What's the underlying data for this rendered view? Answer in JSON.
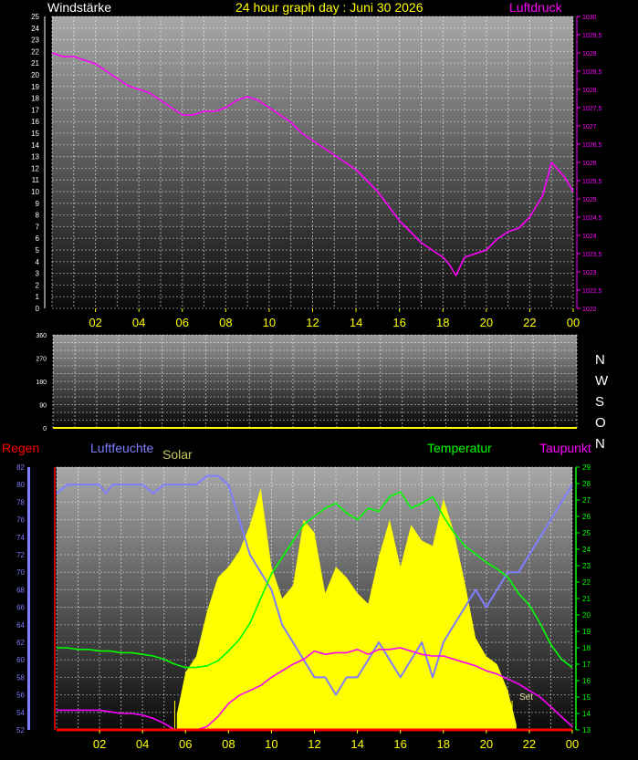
{
  "header": {
    "left_label": "Windstärke",
    "title": "24 hour graph day : Juni 30 2026",
    "right_label": "Luftdruck"
  },
  "bottom_legend": {
    "rain": "Regen",
    "humidity": "Luftfeuchte",
    "solar": "Solar",
    "temperature": "Temperatur",
    "dewpoint": "Taupunkt",
    "sunset_marker": "Set"
  },
  "compass": [
    "N",
    "W",
    "S",
    "O",
    "N"
  ],
  "colors": {
    "pressure": "#ff00ff",
    "temperature": "#00ff00",
    "dewpoint": "#ff00ff",
    "humidity": "#7f7fff",
    "solar": "#ffff00",
    "rain": "#ff0000",
    "hour_labels": "#ffff00"
  },
  "chart_data": [
    {
      "type": "line",
      "name": "wind_pressure",
      "x_ticks": [
        "02",
        "04",
        "06",
        "08",
        "10",
        "12",
        "14",
        "16",
        "18",
        "20",
        "22",
        "00"
      ],
      "y_left": {
        "min": 0,
        "max": 25,
        "ticks": [
          "0",
          "1",
          "2",
          "3",
          "4",
          "5",
          "6",
          "7",
          "8",
          "9",
          "10",
          "11",
          "12",
          "13",
          "14",
          "15",
          "16",
          "17",
          "18",
          "19",
          "20",
          "21",
          "22",
          "23",
          "24",
          "25"
        ]
      },
      "y_right": {
        "min": 1022,
        "max": 1030,
        "ticks": [
          "1022",
          "1022,5",
          "1023",
          "1023,5",
          "1024",
          "1024,5",
          "1025",
          "1025,5",
          "1026",
          "1026,5",
          "1027",
          "1027,5",
          "1028",
          "1028,5",
          "1029",
          "1029,5",
          "1030"
        ]
      },
      "series": [
        {
          "key": "pressure",
          "axis": "right",
          "x": [
            0,
            0.5,
            1,
            1.5,
            2,
            2.5,
            3,
            3.5,
            4,
            4.5,
            5,
            5.5,
            6,
            6.5,
            7,
            7.5,
            8,
            8.5,
            9,
            9.5,
            10,
            10.5,
            11,
            11.5,
            12,
            12.5,
            13,
            13.5,
            14,
            14.5,
            15,
            15.5,
            16,
            16.5,
            17,
            17.5,
            18,
            18.3,
            18.6,
            19,
            19.5,
            20,
            20.5,
            21,
            21.5,
            22,
            22.3,
            22.6,
            23,
            23.3,
            23.6,
            24
          ],
          "y": [
            1029,
            1028.9,
            1028.9,
            1028.8,
            1028.7,
            1028.5,
            1028.3,
            1028.1,
            1028,
            1027.9,
            1027.7,
            1027.5,
            1027.3,
            1027.3,
            1027.4,
            1027.4,
            1027.5,
            1027.7,
            1027.8,
            1027.7,
            1027.5,
            1027.3,
            1027.1,
            1026.8,
            1026.6,
            1026.4,
            1026.2,
            1026,
            1025.8,
            1025.5,
            1025.2,
            1024.8,
            1024.4,
            1024.1,
            1023.8,
            1023.6,
            1023.4,
            1023.2,
            1022.9,
            1023.4,
            1023.5,
            1023.6,
            1023.9,
            1024.1,
            1024.2,
            1024.5,
            1024.8,
            1025.1,
            1026,
            1025.8,
            1025.6,
            1025.2
          ]
        }
      ]
    },
    {
      "type": "line",
      "name": "wind_direction",
      "x_ticks": [],
      "y_left": {
        "min": 0,
        "max": 360,
        "ticks": [
          "0",
          "90",
          "180",
          "270",
          "360"
        ]
      },
      "series": []
    },
    {
      "type": "line",
      "name": "weather",
      "x_ticks": [
        "02",
        "04",
        "06",
        "08",
        "10",
        "12",
        "14",
        "16",
        "18",
        "20",
        "22",
        "00"
      ],
      "y_left": {
        "min": 52,
        "max": 82,
        "ticks": [
          "52",
          "54",
          "56",
          "58",
          "60",
          "62",
          "64",
          "66",
          "68",
          "70",
          "72",
          "74",
          "76",
          "78",
          "80",
          "82"
        ]
      },
      "y_right": {
        "min": 13,
        "max": 29,
        "ticks": [
          "13",
          "14",
          "15",
          "16",
          "17",
          "18",
          "19",
          "20",
          "21",
          "22",
          "23",
          "24",
          "25",
          "26",
          "27",
          "28",
          "29"
        ]
      },
      "series": [
        {
          "key": "humidity",
          "axis": "left",
          "x": [
            0,
            0.5,
            1,
            2,
            2.3,
            2.6,
            3,
            4,
            4.5,
            5,
            6,
            6.5,
            7,
            7.5,
            8,
            8.5,
            9,
            9.5,
            10,
            10.5,
            11,
            11.5,
            12,
            12.5,
            13,
            13.5,
            14,
            14.5,
            15,
            15.5,
            16,
            16.5,
            17,
            17.5,
            18,
            18.5,
            19,
            19.5,
            20,
            20.5,
            21,
            21.5,
            22,
            22.5,
            23,
            23.5,
            24
          ],
          "y": [
            79,
            80,
            80,
            80,
            79,
            80,
            80,
            80,
            79,
            80,
            80,
            80,
            81,
            81,
            80,
            76,
            72,
            70,
            68,
            64,
            62,
            60,
            58,
            58,
            56,
            58,
            58,
            60,
            62,
            60,
            58,
            60,
            62,
            58,
            62,
            64,
            66,
            68,
            66,
            68,
            70,
            70,
            72,
            74,
            76,
            78,
            80
          ]
        },
        {
          "key": "temperature",
          "axis": "right",
          "x": [
            0,
            0.5,
            1,
            1.5,
            2,
            2.5,
            3,
            3.5,
            4,
            4.5,
            5,
            5.5,
            6,
            6.5,
            7,
            7.5,
            8,
            8.5,
            9,
            9.5,
            10,
            10.5,
            11,
            11.5,
            12,
            12.5,
            13,
            13.5,
            14,
            14.5,
            15,
            15.5,
            16,
            16.5,
            17,
            17.5,
            18,
            18.5,
            19,
            19.5,
            20,
            20.5,
            21,
            21.5,
            22,
            22.5,
            23,
            23.5,
            24
          ],
          "y": [
            18,
            18,
            17.9,
            17.9,
            17.8,
            17.8,
            17.7,
            17.7,
            17.6,
            17.5,
            17.3,
            17.0,
            16.8,
            16.8,
            16.9,
            17.2,
            17.8,
            18.5,
            19.5,
            21,
            22.5,
            23.5,
            24.5,
            25.5,
            26,
            26.5,
            26.8,
            26.2,
            25.8,
            26.5,
            26.3,
            27.2,
            27.5,
            26.5,
            26.8,
            27.2,
            26,
            25,
            24.2,
            23.7,
            23.2,
            22.8,
            22.3,
            21.3,
            20.6,
            19.5,
            18.2,
            17.3,
            16.8
          ]
        },
        {
          "key": "dewpoint",
          "axis": "right",
          "x": [
            0,
            0.5,
            1,
            1.5,
            2,
            2.5,
            3,
            3.5,
            4,
            4.5,
            5,
            5.5,
            6,
            6.5,
            7,
            7.5,
            8,
            8.5,
            9,
            9.5,
            10,
            10.5,
            11,
            11.5,
            12,
            12.5,
            13,
            13.5,
            14,
            14.5,
            15,
            15.5,
            16,
            16.5,
            17,
            17.5,
            18,
            18.5,
            19,
            19.5,
            20,
            20.5,
            21,
            21.5,
            22,
            22.5,
            23,
            23.5,
            24
          ],
          "y": [
            14.2,
            14.2,
            14.2,
            14.2,
            14.2,
            14.1,
            14.0,
            14.0,
            13.9,
            13.7,
            13.4,
            13.0,
            13.0,
            13.0,
            13.2,
            13.8,
            14.6,
            15.1,
            15.4,
            15.7,
            16.2,
            16.6,
            17.0,
            17.3,
            17.8,
            17.6,
            17.7,
            17.7,
            17.9,
            17.6,
            17.9,
            17.9,
            18.0,
            17.8,
            17.6,
            17.5,
            17.5,
            17.3,
            17.1,
            16.9,
            16.6,
            16.4,
            16.1,
            15.8,
            15.4,
            15.0,
            14.4,
            13.8,
            13.2
          ]
        },
        {
          "key": "solar",
          "axis": "right",
          "scale": "relative",
          "x": [
            5.6,
            6,
            6.5,
            7,
            7.5,
            8,
            8.5,
            9,
            9.5,
            10,
            10.5,
            11,
            11.5,
            12,
            12.5,
            13,
            13.5,
            14,
            14.5,
            15,
            15.5,
            16,
            16.5,
            17,
            17.5,
            18,
            18.5,
            19,
            19.5,
            20,
            20.5,
            21,
            21.4
          ],
          "y": [
            0.06,
            0.22,
            0.28,
            0.45,
            0.58,
            0.62,
            0.68,
            0.78,
            0.92,
            0.62,
            0.5,
            0.55,
            0.8,
            0.75,
            0.52,
            0.62,
            0.58,
            0.52,
            0.48,
            0.66,
            0.8,
            0.62,
            0.78,
            0.72,
            0.7,
            0.88,
            0.75,
            0.56,
            0.35,
            0.28,
            0.25,
            0.15,
            0.02
          ]
        },
        {
          "key": "rain",
          "axis": "left",
          "x": [
            0,
            24
          ],
          "y": [
            52,
            52
          ]
        }
      ]
    }
  ]
}
